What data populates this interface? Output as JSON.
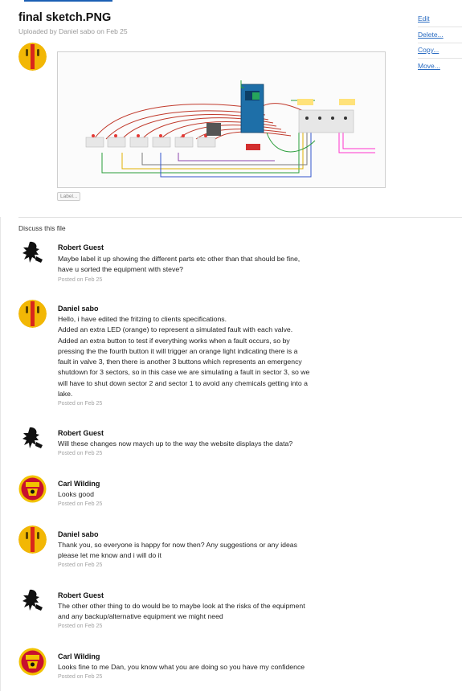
{
  "file": {
    "title": "final sketch.PNG",
    "uploaded": "Uploaded by Daniel sabo on Feb 25",
    "label_chip": "Label..."
  },
  "actions": {
    "edit": "Edit",
    "delete": "Delete...",
    "copy": "Copy...",
    "move": "Move..."
  },
  "discussion": {
    "heading": "Discuss this file",
    "comments": [
      {
        "author": "Robert Guest",
        "avatar": "lion-icon",
        "line1": "Maybe label it up showing the different parts etc other than that should be fine,",
        "line2": "have u sorted the equipment with steve?",
        "date": "Posted on Feb 25"
      },
      {
        "author": "Daniel sabo",
        "avatar": "yellow-helmet-icon",
        "line1": "Hello, i have edited the fritzing to clients specifications.",
        "line2": "Added an extra LED (orange) to represent a simulated fault with each valve.",
        "line3": "Added an extra button to test if everything works when a fault occurs, so by",
        "line4": "pressing the the fourth button it will trigger an orange light indicating there is a",
        "line5": "fault in valve 3, then there is another 3 buttons which represents an emergency",
        "line6": "shutdown for 3 sectors, so in this case we are simulating a fault in sector 3, so we",
        "line7": "will have to shut down sector 2 and sector 1 to avoid any chemicals getting into a",
        "line8": "lake.",
        "date": "Posted on Feb 25"
      },
      {
        "author": "Robert Guest",
        "avatar": "lion-icon",
        "line1": "Will these changes now maych up to the way the website displays the data?",
        "date": "Posted on Feb 25"
      },
      {
        "author": "Carl Wilding",
        "avatar": "club-crest-icon",
        "line1": "Looks good",
        "date": "Posted on Feb 25"
      },
      {
        "author": "Daniel sabo",
        "avatar": "yellow-helmet-icon",
        "line1": "Thank you, so everyone is happy for now then? Any suggestions or any ideas",
        "line2": "please let me know and i will do it",
        "date": "Posted on Feb 25"
      },
      {
        "author": "Robert Guest",
        "avatar": "lion-icon",
        "line1": "The other other thing to do would be to maybe look at the risks of the equipment",
        "line2": "and any backup/alternative equipment we might need",
        "date": "Posted on Feb 25"
      },
      {
        "author": "Carl Wilding",
        "avatar": "club-crest-icon",
        "line1": "Looks fine to me Dan, you know what you are doing so you have my confidence",
        "date": "Posted on Feb 25"
      }
    ]
  },
  "colors": {
    "link": "#2a6cc2",
    "muted": "#999999",
    "helmet_yellow": "#f2b705",
    "helmet_red": "#d9261c",
    "crest_red": "#c8102e"
  }
}
